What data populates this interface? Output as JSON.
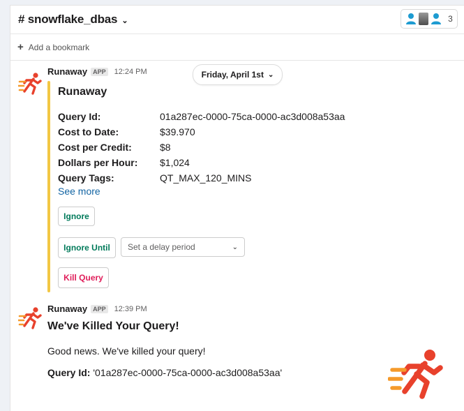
{
  "channel": {
    "name": "# snowflake_dbas",
    "member_count": "3"
  },
  "bookmark": {
    "label": "Add a bookmark"
  },
  "date_divider": {
    "label": "Friday, April 1st"
  },
  "message1": {
    "sender": "Runaway",
    "badge": "APP",
    "time": "12:24 PM",
    "title": "Runaway",
    "fields": [
      {
        "label": "Query Id:",
        "value": "01a287ec-0000-75ca-0000-ac3d008a53aa"
      },
      {
        "label": "Cost to Date:",
        "value": "$39.970"
      },
      {
        "label": "Cost per Credit:",
        "value": "$8"
      },
      {
        "label": "Dollars per Hour:",
        "value": "$1,024"
      },
      {
        "label": "Query Tags:",
        "value": "QT_MAX_120_MINS"
      }
    ],
    "see_more": "See more",
    "ignore_label": "Ignore",
    "ignore_until_label": "Ignore Until",
    "delay_placeholder": "Set a delay period",
    "kill_label": "Kill Query"
  },
  "message2": {
    "sender": "Runaway",
    "badge": "APP",
    "time": "12:39 PM",
    "title": "We've Killed Your Query!",
    "text": "Good news. We've killed your query!",
    "query_id_label": "Query Id:",
    "query_id_value": " '01a287ec-0000-75ca-0000-ac3d008a53aa'"
  },
  "colors": {
    "accent_bar": "#f2c744",
    "green": "#007a5a",
    "red": "#e01e5a",
    "link": "#1264a3",
    "logo_red": "#e8412c",
    "logo_orange": "#f59a2b",
    "member_icon": "#1d9bd1"
  },
  "icons": {
    "members": "person-icon",
    "bookmark": "plus-icon",
    "dropdown": "chevron-down-icon",
    "avatar": "running-man-icon"
  }
}
